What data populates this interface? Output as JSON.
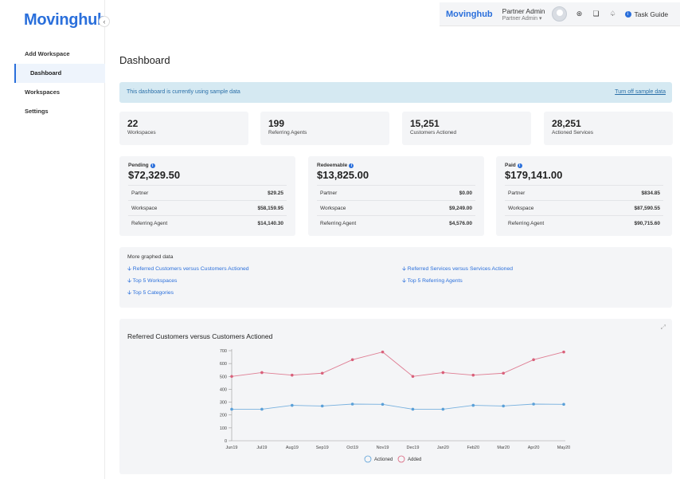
{
  "app": {
    "logo": "Movinghub"
  },
  "header": {
    "brand": "Movinghub",
    "user_name": "Partner Admin",
    "user_role": "Partner Admin ▾",
    "task_guide": "Task Guide"
  },
  "sidebar": {
    "items": [
      {
        "label": "Add Workspace",
        "active": false
      },
      {
        "label": "Dashboard",
        "active": true
      },
      {
        "label": "Workspaces",
        "active": false
      },
      {
        "label": "Settings",
        "active": false
      }
    ]
  },
  "page": {
    "title": "Dashboard",
    "banner_text": "This dashboard is currently using sample data",
    "banner_link": "Turn off sample data"
  },
  "stats": [
    {
      "value": "22",
      "label": "Workspaces"
    },
    {
      "value": "199",
      "label": "Referring Agents"
    },
    {
      "value": "15,251",
      "label": "Customers Actioned"
    },
    {
      "value": "28,251",
      "label": "Actioned Services"
    }
  ],
  "money": [
    {
      "label": "Pending",
      "total": "$72,329.50",
      "rows": [
        {
          "name": "Partner",
          "amount": "$29.25"
        },
        {
          "name": "Workspace",
          "amount": "$58,159.95"
        },
        {
          "name": "Referring Agent",
          "amount": "$14,140.30"
        }
      ]
    },
    {
      "label": "Redeemable",
      "total": "$13,825.00",
      "rows": [
        {
          "name": "Partner",
          "amount": "$0.00"
        },
        {
          "name": "Workspace",
          "amount": "$9,249.00"
        },
        {
          "name": "Referring Agent",
          "amount": "$4,576.00"
        }
      ]
    },
    {
      "label": "Paid",
      "total": "$179,141.00",
      "rows": [
        {
          "name": "Partner",
          "amount": "$834.85"
        },
        {
          "name": "Workspace",
          "amount": "$87,590.55"
        },
        {
          "name": "Referring Agent",
          "amount": "$90,715.60"
        }
      ]
    }
  ],
  "graphed": {
    "title": "More graphed data",
    "links": [
      "Referred Customers versus Customers Actioned",
      "Top 5 Workspaces",
      "Top 5 Categories",
      "Referred Services versus Services Actioned",
      "Top 5 Referring Agents"
    ]
  },
  "chart_data": {
    "type": "line",
    "title": "Referred Customers versus Customers Actioned",
    "categories": [
      "Jun19",
      "Jul19",
      "Aug19",
      "Sep19",
      "Oct19",
      "Nov19",
      "Dec19",
      "Jan20",
      "Feb20",
      "Mar20",
      "Apr20",
      "May20"
    ],
    "ylim": [
      0,
      700
    ],
    "yticks": [
      0,
      100,
      200,
      300,
      400,
      500,
      600,
      700
    ],
    "series": [
      {
        "name": "Actioned",
        "color": "#5aa0d8",
        "values": [
          245,
          245,
          275,
          270,
          285,
          283,
          245,
          245,
          275,
          270,
          285,
          283
        ]
      },
      {
        "name": "Added",
        "color": "#d9607a",
        "values": [
          500,
          530,
          510,
          525,
          630,
          690,
          500,
          530,
          510,
          525,
          630,
          690
        ]
      }
    ],
    "legend": "bottom"
  }
}
